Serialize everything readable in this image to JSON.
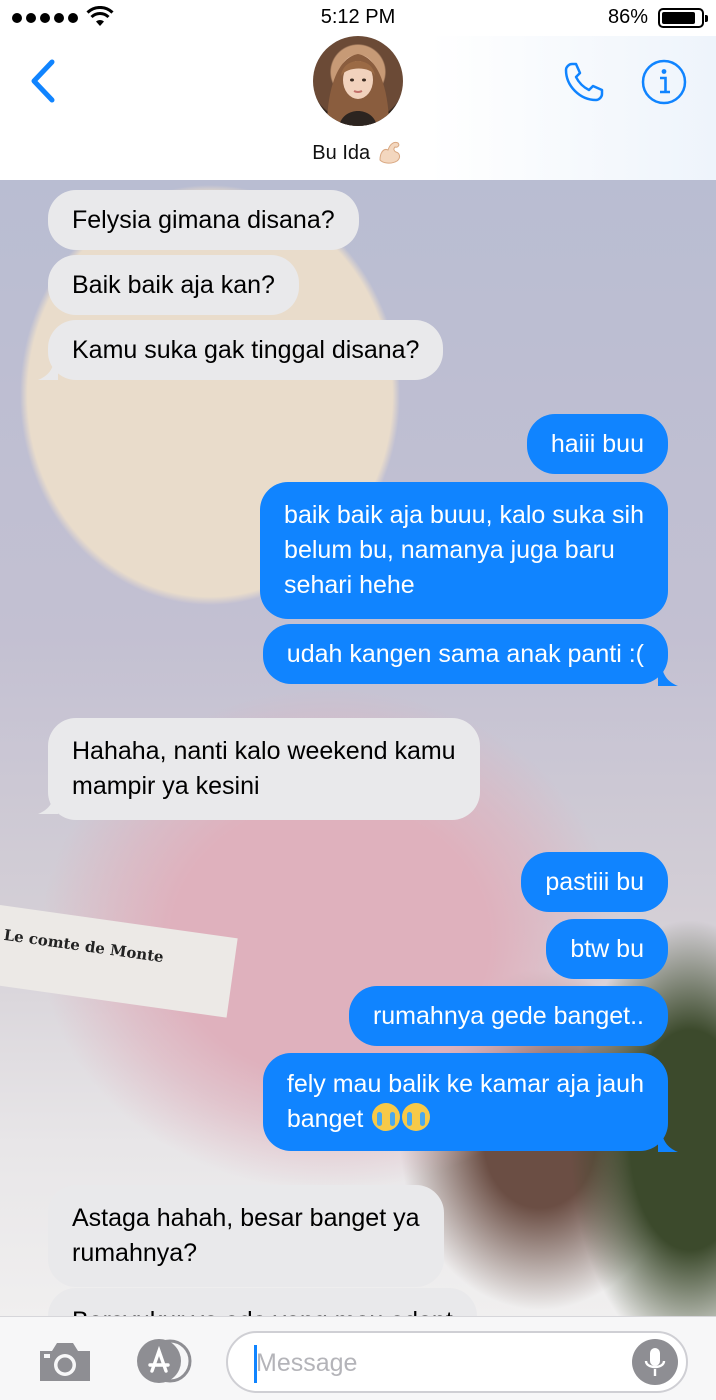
{
  "status_bar": {
    "time": "5:12 PM",
    "battery_percent_label": "86%",
    "battery_level": 0.86,
    "signal_bars": 5,
    "wifi_icon": "wifi-icon"
  },
  "header": {
    "contact_name": "Bu Ida",
    "contact_emoji": "💪🏻",
    "back_icon": "chevron-left-icon",
    "call_icon": "phone-icon",
    "info_icon": "info-icon"
  },
  "wallpaper": {
    "label_text": "Le comte de Monte"
  },
  "messages": [
    {
      "from": "them",
      "lines": [
        "Felysia gimana disana?"
      ]
    },
    {
      "from": "them",
      "lines": [
        "Baik baik aja kan?"
      ]
    },
    {
      "from": "them",
      "lines": [
        "Kamu suka gak tinggal disana?"
      ]
    },
    {
      "from": "me",
      "lines": [
        "haiii buu"
      ]
    },
    {
      "from": "me",
      "lines": [
        "baik baik aja buuu, kalo suka sih",
        "belum bu, namanya juga baru",
        "sehari hehe"
      ]
    },
    {
      "from": "me",
      "lines": [
        "udah kangen sama anak panti :("
      ]
    },
    {
      "from": "them",
      "lines": [
        "Hahaha, nanti kalo weekend kamu",
        "mampir ya kesini"
      ]
    },
    {
      "from": "me",
      "lines": [
        "pastiii bu"
      ]
    },
    {
      "from": "me",
      "lines": [
        "btw bu"
      ]
    },
    {
      "from": "me",
      "lines": [
        "rumahnya gede banget.."
      ]
    },
    {
      "from": "me",
      "lines": [
        "fely mau balik ke kamar aja jauh",
        "banget"
      ],
      "trailing_emoji": "loudly-crying-face-emoji"
    },
    {
      "from": "them",
      "lines": [
        "Astaga hahah, besar banget ya",
        "rumahnya?"
      ]
    },
    {
      "from": "them",
      "lines": [
        "Bersyukur ya ada yang mau adopt"
      ]
    }
  ],
  "input_bar": {
    "placeholder": "Message",
    "camera_icon": "camera-icon",
    "apps_icon": "app-store-icon",
    "mic_icon": "microphone-icon"
  },
  "colors": {
    "accent": "#1084ff",
    "incoming_bubble": "#e9e9eb",
    "outgoing_bubble": "#1084ff"
  }
}
